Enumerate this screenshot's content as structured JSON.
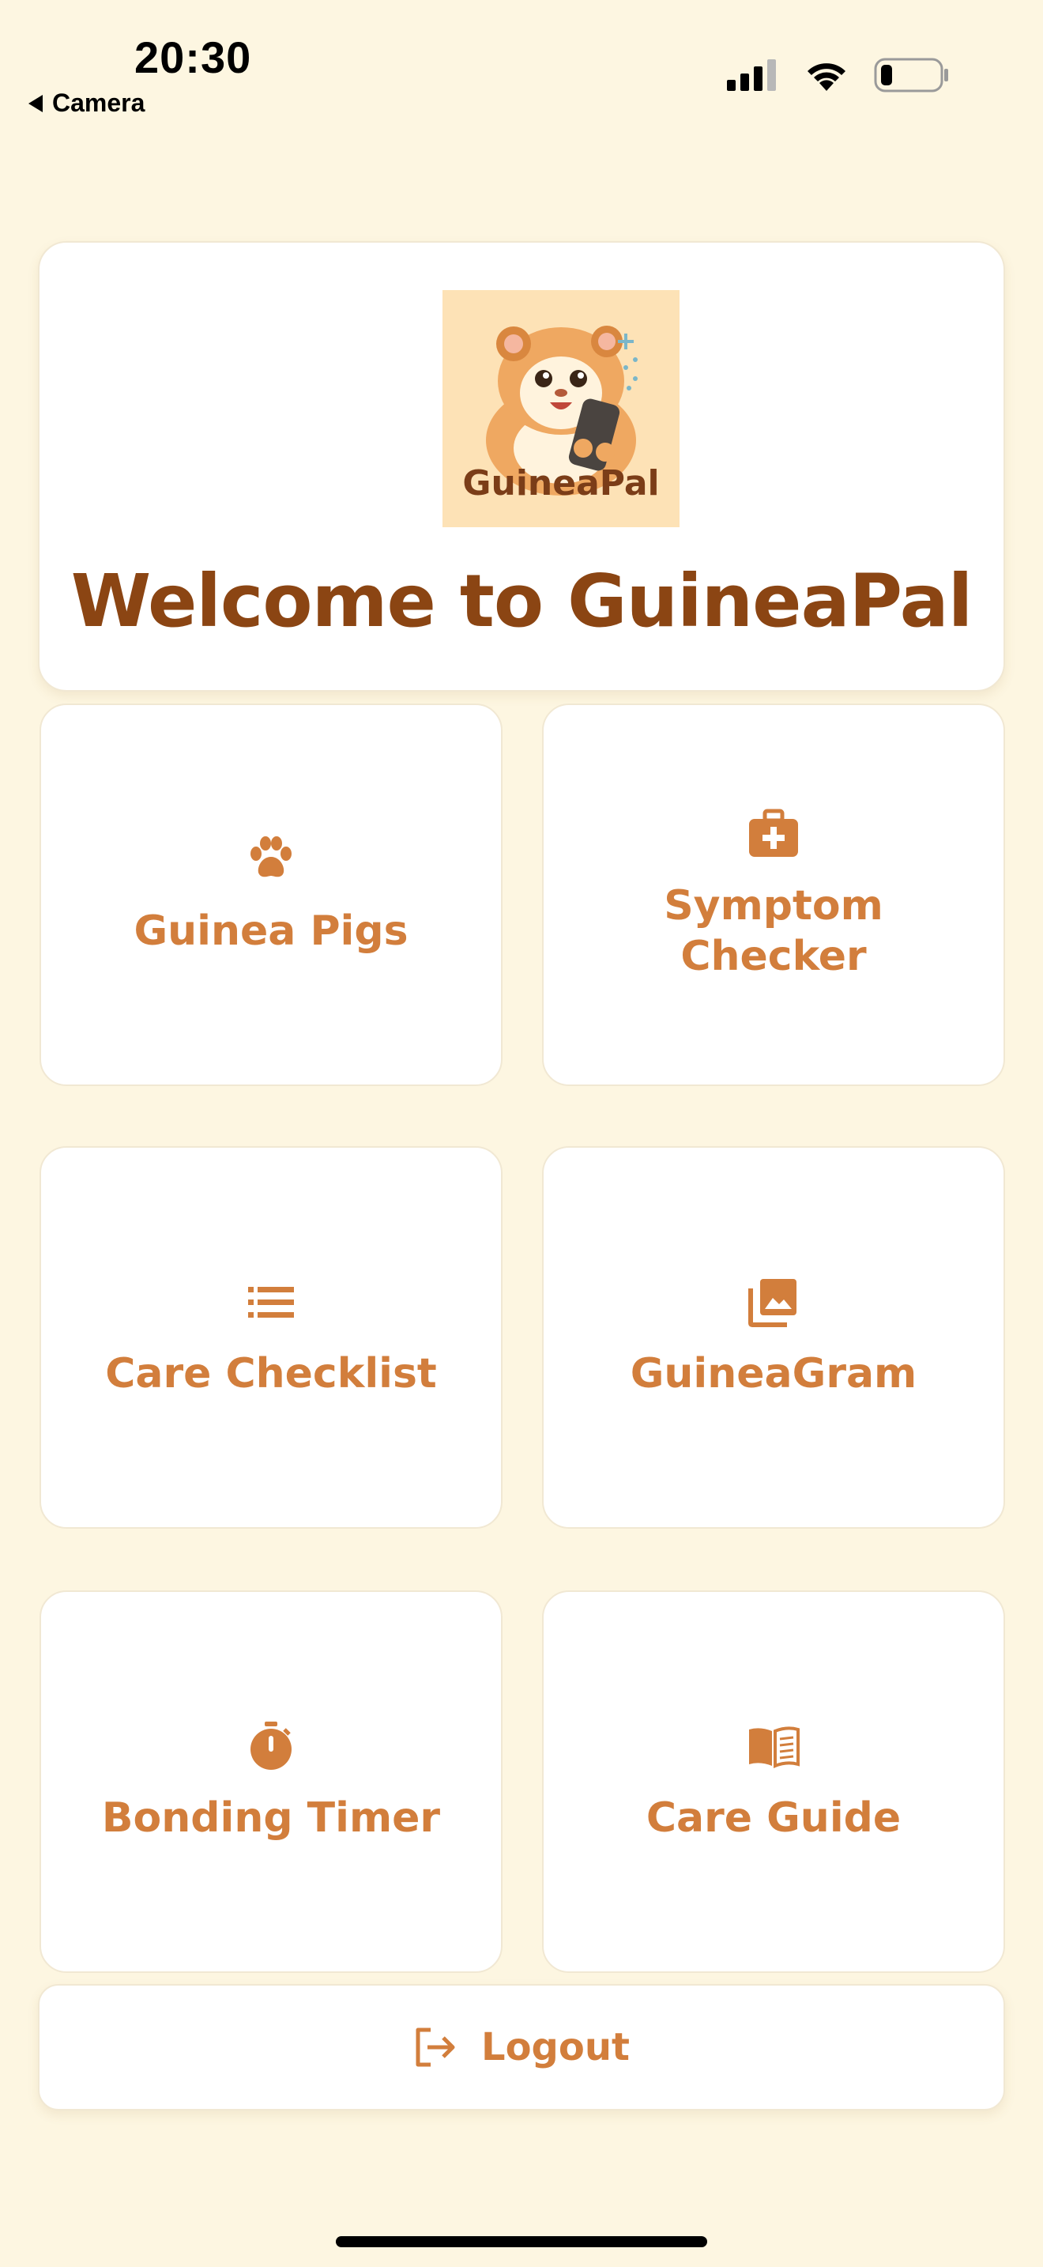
{
  "status_bar": {
    "time": "20:30",
    "back_label": "Camera"
  },
  "welcome": {
    "logo_text": "GuineaPal",
    "title": "Welcome to GuineaPal"
  },
  "tiles": [
    {
      "label": "Guinea Pigs",
      "icon": "paw-icon"
    },
    {
      "label": "Symptom Checker",
      "icon": "medical-kit-icon"
    },
    {
      "label": "Care Checklist",
      "icon": "list-icon"
    },
    {
      "label": "GuineaGram",
      "icon": "photo-library-icon"
    },
    {
      "label": "Bonding Timer",
      "icon": "stopwatch-icon"
    },
    {
      "label": "Care Guide",
      "icon": "book-icon"
    }
  ],
  "logout": {
    "label": "Logout",
    "icon": "logout-icon"
  },
  "colors": {
    "background": "#fdf6e1",
    "title_brown": "#8b4513",
    "accent_orange": "#d27e3c",
    "card": "#ffffff"
  }
}
